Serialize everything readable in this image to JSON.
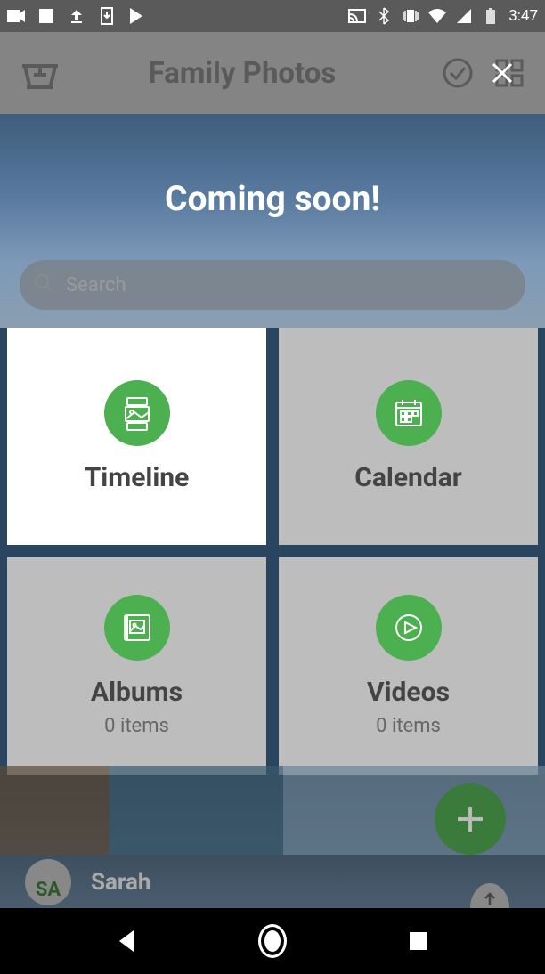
{
  "status_bar": {
    "time": "3:47"
  },
  "header": {
    "title": "Family Photos"
  },
  "hero": {
    "message": "Coming soon!"
  },
  "search": {
    "placeholder": "Search"
  },
  "tiles": [
    {
      "label": "Timeline",
      "subtitle": ""
    },
    {
      "label": "Calendar",
      "subtitle": ""
    },
    {
      "label": "Albums",
      "subtitle": "0 items"
    },
    {
      "label": "Videos",
      "subtitle": "0 items"
    }
  ],
  "user": {
    "initials": "SA",
    "name": "Sarah"
  },
  "colors": {
    "accent": "#4CAF50",
    "background_overlay": "#5a5a5a",
    "tile_inactive": "#bdbdbd",
    "tile_active": "#ffffff"
  }
}
